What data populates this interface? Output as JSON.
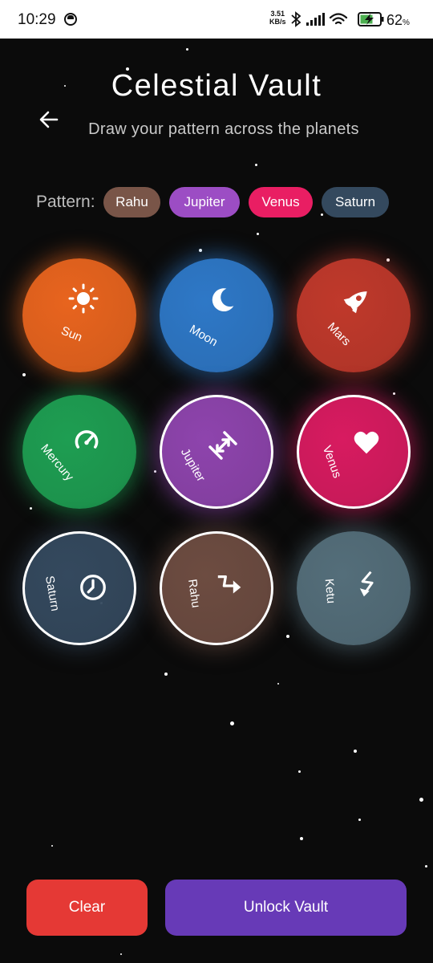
{
  "status_bar": {
    "time": "10:29",
    "net_speed_value": "3.51",
    "net_speed_unit": "KB/s",
    "battery_level": "62",
    "battery_unit": "%"
  },
  "header": {
    "title": "Celestial Vault",
    "subtitle": "Draw your pattern across the planets"
  },
  "pattern": {
    "label": "Pattern:",
    "chips": [
      {
        "label": "Rahu",
        "color": "#795548"
      },
      {
        "label": "Jupiter",
        "color": "#9c4dc4"
      },
      {
        "label": "Venus",
        "color": "#e91e63"
      },
      {
        "label": "Saturn",
        "color": "#34495e"
      }
    ]
  },
  "planets": [
    {
      "name": "Sun",
      "color": "#e8641e",
      "icon": "sun-icon",
      "selected": false
    },
    {
      "name": "Moon",
      "color": "#2e78c7",
      "icon": "moon-icon",
      "selected": false
    },
    {
      "name": "Mars",
      "color": "#c0392b",
      "icon": "rocket-icon",
      "selected": false
    },
    {
      "name": "Mercury",
      "color": "#1e9e52",
      "icon": "speedometer-icon",
      "selected": false
    },
    {
      "name": "Jupiter",
      "color": "#8e44ad",
      "icon": "resize-icon",
      "selected": true
    },
    {
      "name": "Venus",
      "color": "#d81b60",
      "icon": "heart-icon",
      "selected": true
    },
    {
      "name": "Saturn",
      "color": "#34495e",
      "icon": "clock-icon",
      "selected": true
    },
    {
      "name": "Rahu",
      "color": "#6d4c41",
      "icon": "zigzag-arrow-icon",
      "selected": true
    },
    {
      "name": "Ketu",
      "color": "#546e7a",
      "icon": "lightning-arrow-icon",
      "selected": false
    }
  ],
  "actions": {
    "clear_label": "Clear",
    "clear_color": "#e53935",
    "unlock_label": "Unlock Vault",
    "unlock_color": "#673ab7"
  }
}
